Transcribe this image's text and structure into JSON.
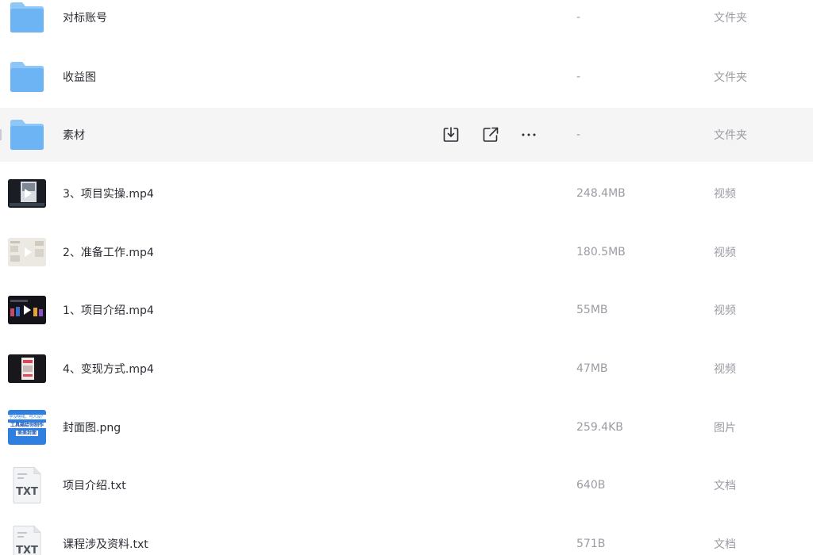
{
  "colors": {
    "folder": "#6cb4f4",
    "folder_back": "#8ec6f8",
    "name_text": "#2b2d33",
    "meta_text": "#9a9ca3",
    "hover_bg": "#f5f5f6"
  },
  "rows": [
    {
      "name": "对标账号",
      "size": "-",
      "type": "文件夹",
      "icon": "folder-icon"
    },
    {
      "name": "收益图",
      "size": "-",
      "type": "文件夹",
      "icon": "folder-icon"
    },
    {
      "name": "素材",
      "size": "-",
      "type": "文件夹",
      "icon": "folder-icon",
      "hovered": true
    },
    {
      "name": "3、项目实操.mp4",
      "size": "248.4MB",
      "type": "视频",
      "icon": "video-thumbnail"
    },
    {
      "name": "2、准备工作.mp4",
      "size": "180.5MB",
      "type": "视频",
      "icon": "video-thumbnail"
    },
    {
      "name": "1、项目介绍.mp4",
      "size": "55MB",
      "type": "视频",
      "icon": "video-thumbnail"
    },
    {
      "name": "4、变现方式.mp4",
      "size": "47MB",
      "type": "视频",
      "icon": "video-thumbnail"
    },
    {
      "name": "封面图.png",
      "size": "259.4KB",
      "type": "图片",
      "icon": "image-thumbnail",
      "thumb_text": [
        "学没啥钱，可人设？",
        "工具箱给你制作",
        "美美封面"
      ]
    },
    {
      "name": "项目介绍.txt",
      "size": "640B",
      "type": "文档",
      "icon": "txt-file-icon",
      "badge": "TXT"
    },
    {
      "name": "课程涉及资料.txt",
      "size": "571B",
      "type": "文档",
      "icon": "txt-file-icon",
      "badge": "TXT"
    }
  ],
  "row_actions": [
    "download-icon",
    "share-icon",
    "more-icon"
  ]
}
